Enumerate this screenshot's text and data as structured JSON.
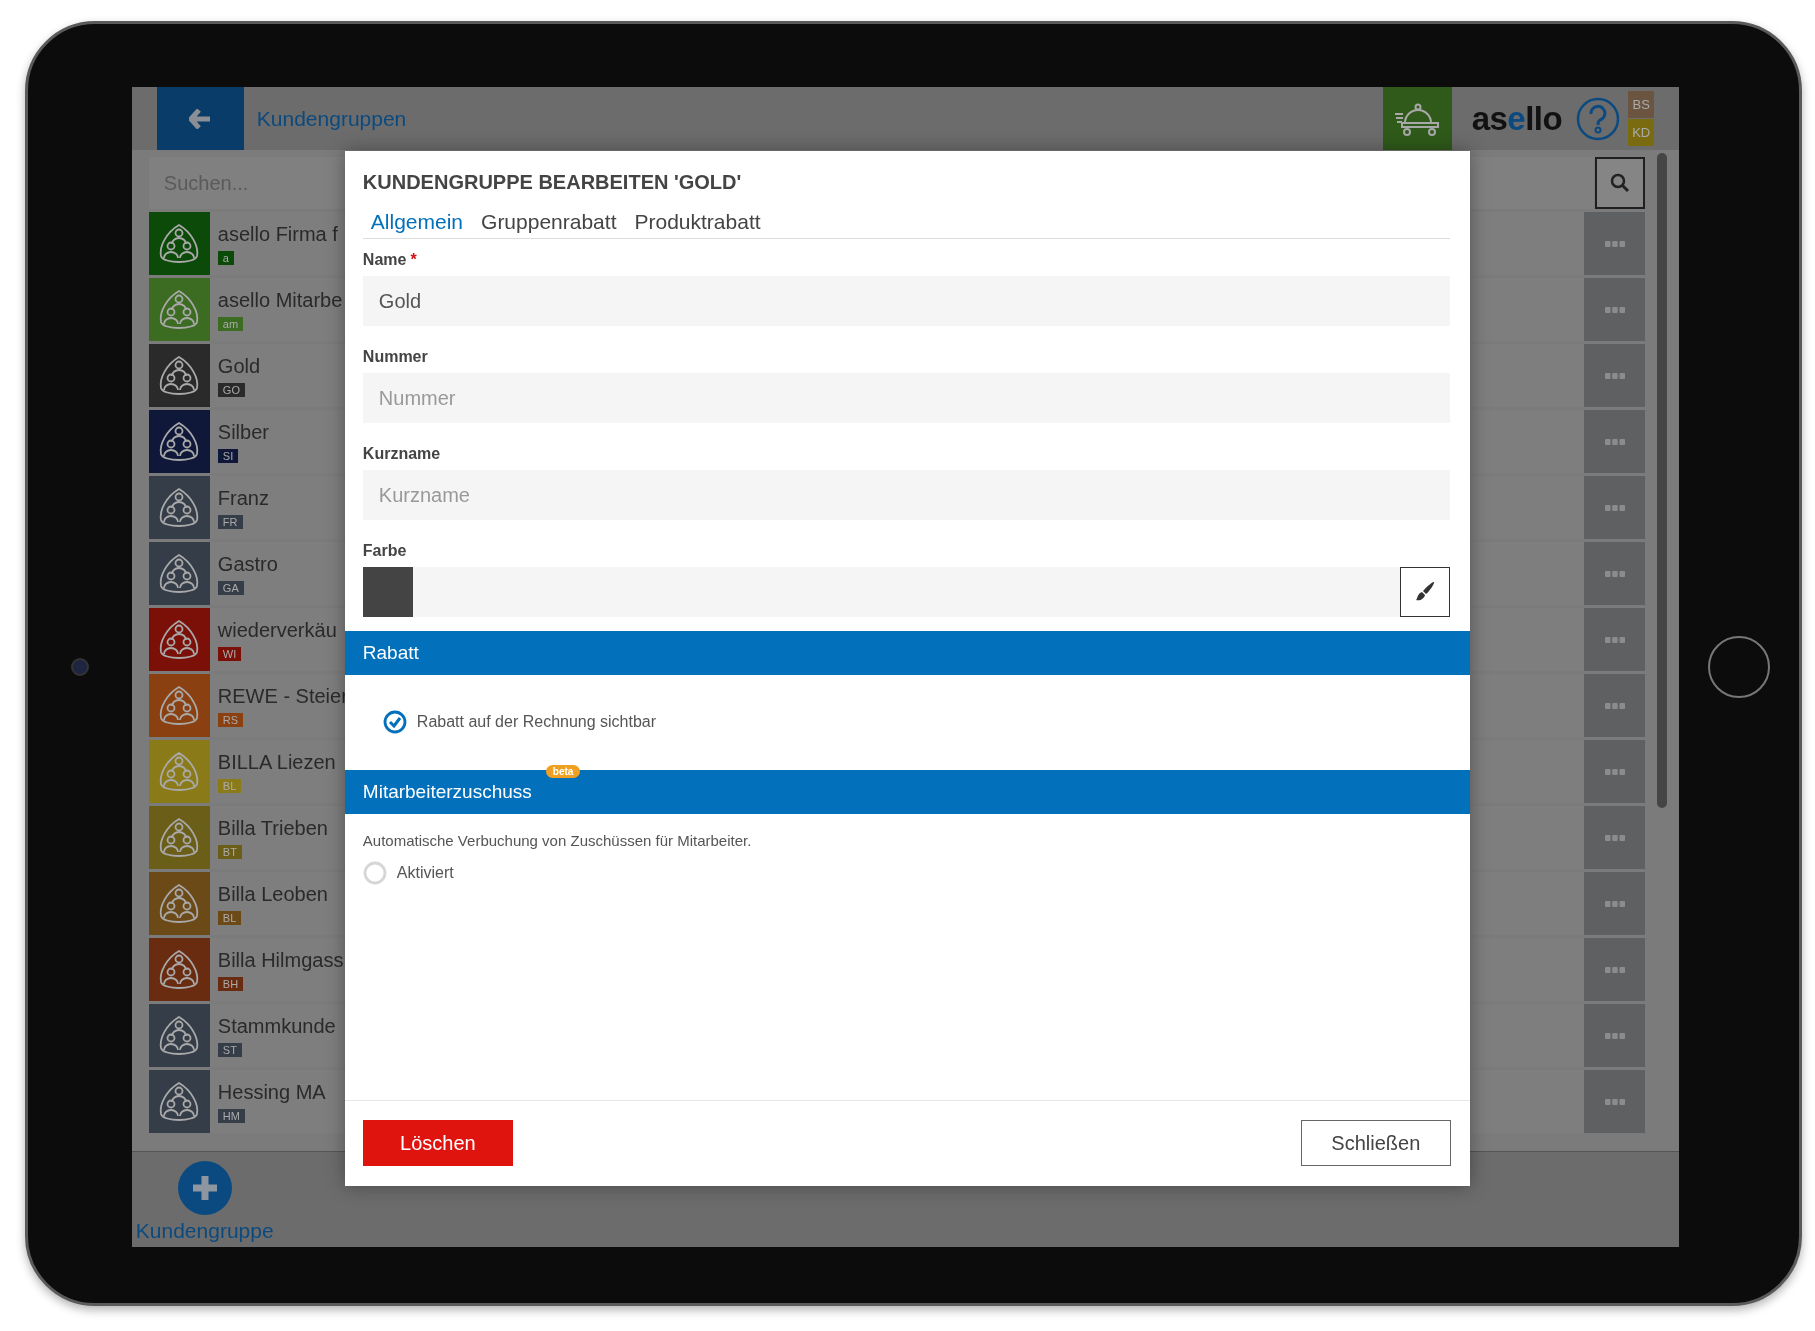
{
  "header": {
    "title": "Kundengruppen",
    "logo": "asello",
    "user_badges": [
      {
        "label": "BS",
        "color": "#6b5540"
      },
      {
        "label": "KD",
        "color": "#7a6a10"
      }
    ]
  },
  "search": {
    "placeholder": "Suchen..."
  },
  "groups": [
    {
      "name": "asello Firma f",
      "code": "a",
      "color": "#0b4a08"
    },
    {
      "name": "asello Mitarbe",
      "code": "am",
      "color": "#3c6b22"
    },
    {
      "name": "Gold",
      "code": "GO",
      "color": "#2a2a2a"
    },
    {
      "name": "Silber",
      "code": "SI",
      "color": "#10183a"
    },
    {
      "name": "Franz",
      "code": "FR",
      "color": "#353d48"
    },
    {
      "name": "Gastro",
      "code": "GA",
      "color": "#353d48"
    },
    {
      "name": "wiederverkäu",
      "code": "WI",
      "color": "#7a1008"
    },
    {
      "name": "REWE - Steier",
      "code": "RS",
      "color": "#8a4010"
    },
    {
      "name": "BILLA Liezen",
      "code": "BL",
      "color": "#8a7a18"
    },
    {
      "name": "Billa Trieben",
      "code": "BT",
      "color": "#6b5e18"
    },
    {
      "name": "Billa Leoben",
      "code": "BL",
      "color": "#6b4a18"
    },
    {
      "name": "Billa Hilmgass",
      "code": "BH",
      "color": "#6a2c10"
    },
    {
      "name": "Stammkunde",
      "code": "ST",
      "color": "#353d48"
    },
    {
      "name": "Hessing MA",
      "code": "HM",
      "color": "#353d48"
    }
  ],
  "bottom_bar": {
    "add_label": "Kundengruppe"
  },
  "dialog": {
    "title": "KUNDENGRUPPE BEARBEITEN 'GOLD'",
    "tabs": [
      {
        "label": "Allgemein",
        "selected": true
      },
      {
        "label": "Gruppenrabatt",
        "selected": false
      },
      {
        "label": "Produktrabatt",
        "selected": false
      }
    ],
    "fields": [
      {
        "kind": "text",
        "label": "Name",
        "required_mark": "*",
        "value": "Gold"
      },
      {
        "kind": "text",
        "label": "Nummer",
        "placeholder": "Nummer"
      },
      {
        "kind": "text",
        "label": "Kurzname",
        "placeholder": "Kurzname"
      },
      {
        "kind": "color",
        "label": "Farbe",
        "color": "#444444"
      }
    ],
    "sections": [
      {
        "title": "Rabatt",
        "options": [
          {
            "kind": "checkbox",
            "label": "Rabatt auf der Rechnung sichtbar",
            "checked": true
          }
        ]
      },
      {
        "title": "Mitarbeiterzuschuss",
        "badge": "beta",
        "description": "Automatische Verbuchung von Zuschüssen für Mitarbeiter.",
        "options": [
          {
            "kind": "radio",
            "label": "Aktiviert",
            "checked": false
          }
        ]
      }
    ],
    "buttons": [
      {
        "kind": "danger",
        "label": "Löschen"
      },
      {
        "kind": "secondary",
        "label": "Schließen"
      }
    ]
  }
}
